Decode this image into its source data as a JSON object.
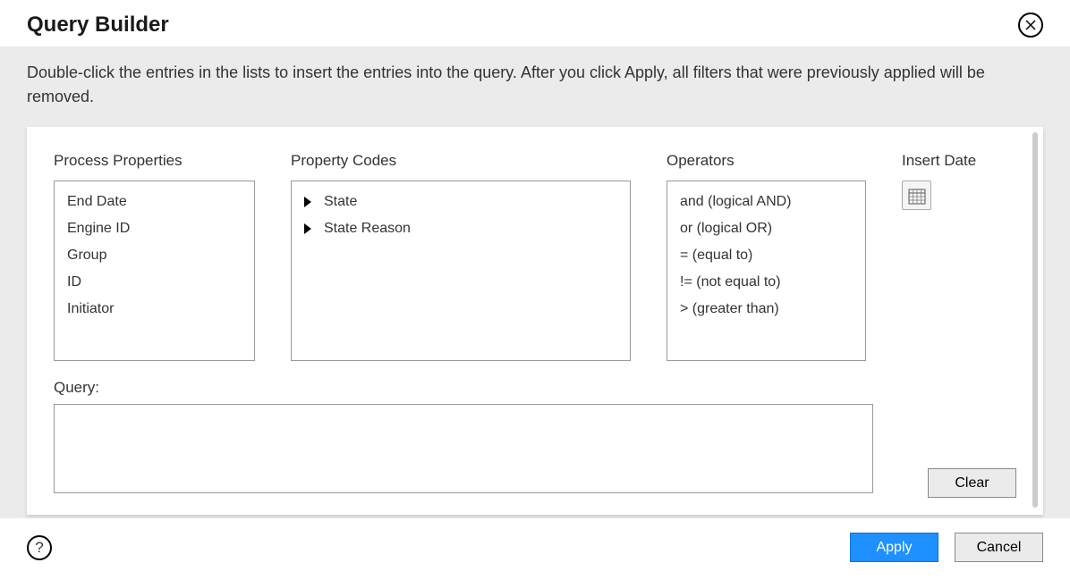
{
  "header": {
    "title": "Query Builder"
  },
  "instructions": "Double-click the entries in the lists to insert the entries into the query. After you click Apply, all filters that were previously applied will be removed.",
  "columns": {
    "process_properties": {
      "header": "Process Properties",
      "items": [
        "End Date",
        "Engine ID",
        "Group",
        "ID",
        "Initiator"
      ]
    },
    "property_codes": {
      "header": "Property Codes",
      "items": [
        "State",
        "State Reason"
      ]
    },
    "operators": {
      "header": "Operators",
      "items": [
        "and (logical AND)",
        "or (logical OR)",
        "= (equal to)",
        "!= (not equal to)",
        "> (greater than)"
      ]
    },
    "insert_date": {
      "header": "Insert Date"
    }
  },
  "query": {
    "label": "Query:",
    "value": ""
  },
  "buttons": {
    "clear": "Clear",
    "apply": "Apply",
    "cancel": "Cancel",
    "help": "?"
  }
}
